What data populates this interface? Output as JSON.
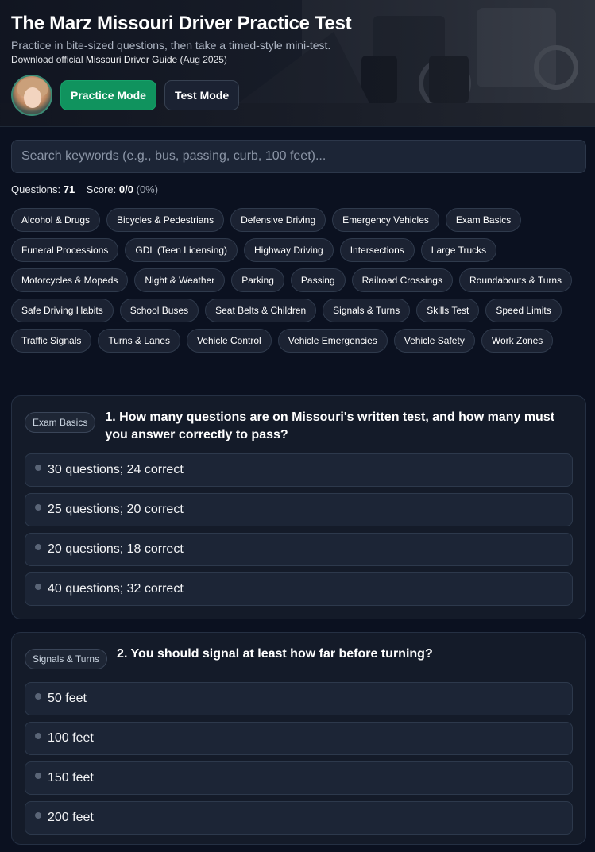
{
  "header": {
    "title": "The Marz Missouri Driver Practice Test",
    "subtitle": "Practice in bite-sized questions, then take a timed-style mini-test.",
    "download_prefix": "Download official",
    "guide_link": "Missouri Driver Guide",
    "guide_date": "(Aug 2025)",
    "modes": [
      {
        "label": "Practice Mode",
        "active": true
      },
      {
        "label": "Test Mode",
        "active": false
      }
    ]
  },
  "search": {
    "placeholder": "Search keywords (e.g., bus, passing, curb, 100 feet)..."
  },
  "stats": {
    "questions_label": "Questions:",
    "questions_count": "71",
    "score_label": "Score:",
    "score_value": "0/0",
    "score_pct": "(0%)"
  },
  "categories": [
    "Alcohol & Drugs",
    "Bicycles & Pedestrians",
    "Defensive Driving",
    "Emergency Vehicles",
    "Exam Basics",
    "Funeral Processions",
    "GDL (Teen Licensing)",
    "Highway Driving",
    "Intersections",
    "Large Trucks",
    "Motorcycles & Mopeds",
    "Night & Weather",
    "Parking",
    "Passing",
    "Railroad Crossings",
    "Roundabouts & Turns",
    "Safe Driving Habits",
    "School Buses",
    "Seat Belts & Children",
    "Signals & Turns",
    "Skills Test",
    "Speed Limits",
    "Traffic Signals",
    "Turns & Lanes",
    "Vehicle Control",
    "Vehicle Emergencies",
    "Vehicle Safety",
    "Work Zones"
  ],
  "questions": [
    {
      "category": "Exam Basics",
      "text": "1. How many questions are on Missouri's written test, and how many must you answer correctly to pass?",
      "options": [
        "30 questions; 24 correct",
        "25 questions; 20 correct",
        "20 questions; 18 correct",
        "40 questions; 32 correct"
      ]
    },
    {
      "category": "Signals & Turns",
      "text": "2. You should signal at least how far before turning?",
      "options": [
        "50 feet",
        "100 feet",
        "150 feet",
        "200 feet"
      ]
    }
  ],
  "colors": {
    "background": "#0b1120",
    "accent_active": "#10935e"
  }
}
